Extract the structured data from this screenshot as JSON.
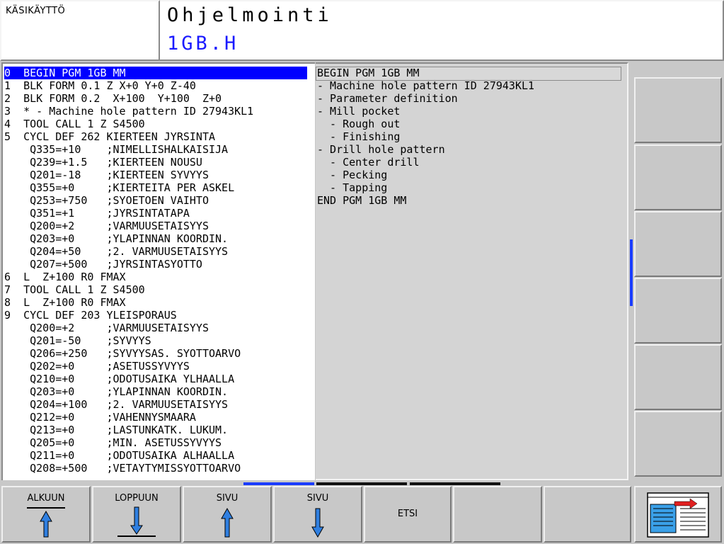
{
  "header": {
    "mode": "KÄSIKÄYTTÖ",
    "title": "Ohjelmointi",
    "file": "1GB.H"
  },
  "program_lines": [
    "0  BEGIN PGM 1GB MM",
    "1  BLK FORM 0.1 Z X+0 Y+0 Z-40",
    "2  BLK FORM 0.2  X+100  Y+100  Z+0",
    "3  * - Machine hole pattern ID 27943KL1",
    "4  TOOL CALL 1 Z S4500",
    "5  CYCL DEF 262 KIERTEEN JYRSINTA",
    "    Q335=+10    ;NIMELLISHALKAISIJA",
    "    Q239=+1.5   ;KIERTEEN NOUSU",
    "    Q201=-18    ;KIERTEEN SYVYYS",
    "    Q355=+0     ;KIERTEITA PER ASKEL",
    "    Q253=+750   ;SYOETOEN VAIHTO",
    "    Q351=+1     ;JYRSINTATAPA",
    "    Q200=+2     ;VARMUUSETAISYYS",
    "    Q203=+0     ;YLAPINNAN KOORDIN.",
    "    Q204=+50    ;2. VARMUUSETAISYYS",
    "    Q207=+500   ;JYRSINTASYOTTO",
    "6  L  Z+100 R0 FMAX",
    "7  TOOL CALL 1 Z S4500",
    "8  L  Z+100 R0 FMAX",
    "9  CYCL DEF 203 YLEISPORAUS",
    "    Q200=+2     ;VARMUUSETAISYYS",
    "    Q201=-50    ;SYVYYS",
    "    Q206=+250   ;SYVYYSAS. SYOTTOARVO",
    "    Q202=+0     ;ASETUSSYVYYS",
    "    Q210=+0     ;ODOTUSAIKA YLHAALLA",
    "    Q203=+0     ;YLAPINNAN KOORDIN.",
    "    Q204=+100   ;2. VARMUUSETAISYYS",
    "    Q212=+0     ;VAHENNYSMAARA",
    "    Q213=+0     ;LASTUNKATK. LUKUM.",
    "    Q205=+0     ;MIN. ASETUSSYVYYS",
    "    Q211=+0     ;ODOTUSAIKA ALHAALLA",
    "    Q208=+500   ;VETAYTYMISSYOTTOARVO"
  ],
  "structure_lines": [
    "BEGIN PGM 1GB MM",
    "- Machine hole pattern ID 27943KL1",
    "- Parameter definition",
    "- Mill pocket",
    "  - Rough out",
    "  - Finishing",
    "- Drill hole pattern",
    "  - Center drill",
    "  - Pecking",
    "  - Tapping",
    "END PGM 1GB MM"
  ],
  "softkeys": {
    "alkuun": "ALKUUN",
    "loppuun": "LOPPUUN",
    "sivu_up": "SIVU",
    "sivu_down": "SIVU",
    "etsi": "ETSI"
  },
  "colors": {
    "selection": "#0000ff",
    "file_name": "#1a1aff",
    "arrow": "#2f7fe0"
  }
}
